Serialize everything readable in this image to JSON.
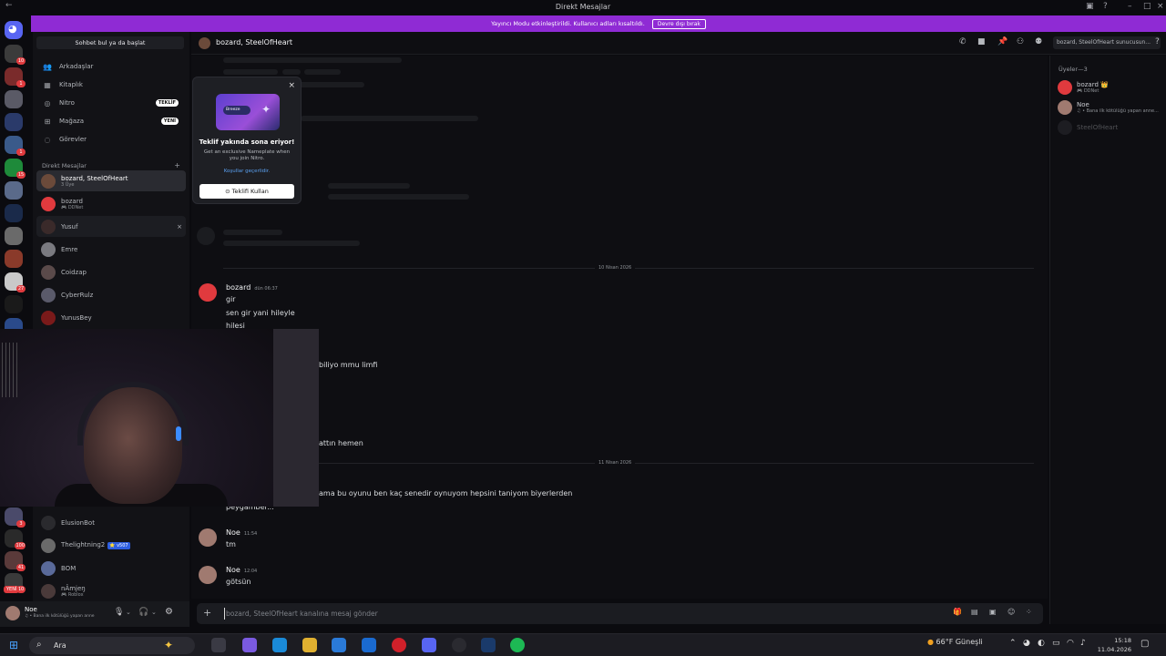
{
  "window": {
    "title": "Direkt Mesajlar"
  },
  "banner": {
    "text": "Yayıncı Modu etkinleştirildi. Kullanıcı adları kısaltıldı.",
    "button": "Devre dışı bırak"
  },
  "server_rail": {
    "badges": [
      "10",
      "1",
      "",
      "",
      "1",
      "15",
      "",
      "",
      "",
      "",
      "27",
      "",
      "",
      "",
      "",
      "",
      "",
      "",
      "",
      "",
      "",
      "3",
      "100",
      "41",
      "10"
    ],
    "new_label": "YENİ"
  },
  "dm_sidebar": {
    "search_label": "Sohbet bul ya da başlat",
    "nav": [
      {
        "label": "Arkadaşlar",
        "icon": "friends-icon",
        "pill": ""
      },
      {
        "label": "Kitaplık",
        "icon": "library-icon",
        "pill": ""
      },
      {
        "label": "Nitro",
        "icon": "nitro-icon",
        "pill": "TEKLİF"
      },
      {
        "label": "Mağaza",
        "icon": "shop-icon",
        "pill": "YENİ"
      },
      {
        "label": "Görevler",
        "icon": "quests-icon",
        "pill": ""
      }
    ],
    "section_label": "Direkt Mesajlar",
    "dms": [
      {
        "name": "bozard, SteelOfHeart",
        "sub": "3 Üye",
        "color": "#6b4a3a"
      },
      {
        "name": "bozard",
        "sub": "🎮 DDNet",
        "color": "#e03a3e"
      },
      {
        "name": "Yusuf",
        "sub": "",
        "color": "#3a2a2a"
      },
      {
        "name": "Emre",
        "sub": "",
        "color": "#7a7a80"
      },
      {
        "name": "Coidzap",
        "sub": "",
        "color": "#5a4a4a"
      },
      {
        "name": "CyberRulz",
        "sub": "",
        "color": "#5a5a6a"
      },
      {
        "name": "YunusBey",
        "sub": "",
        "color": "#7a1a1a"
      },
      {
        "name": "ElusionBot",
        "sub": "",
        "color": "#2a2a2e"
      },
      {
        "name": "Thelightning2",
        "sub": "",
        "color": "#6a6a6a",
        "tag": "⭐ v507"
      },
      {
        "name": "BOM",
        "sub": "",
        "color": "#5a6a9a"
      },
      {
        "name": "nÂmjeŋ",
        "sub": "🎮 Roblox",
        "color": "#4a3a3a"
      }
    ]
  },
  "user_panel": {
    "name": "Noe",
    "status": "♫ • Bana ilk kötülüğü yapan anne"
  },
  "chat_header": {
    "title": "bozard, SteelOfHeart",
    "search_placeholder": "bozard, SteelOfHeart sunucusun..."
  },
  "messages": {
    "dividers": [
      "10 Nisan 2026",
      "11 Nisan 2026"
    ],
    "groups": [
      {
        "author": "bozard",
        "time": "dün 06:37",
        "color": "#e03a3e",
        "lines": [
          "gir",
          "sen gir yani hileyle",
          "hilesi"
        ]
      },
      {
        "author": "",
        "time": "",
        "color": "",
        "lines": [
          "biliyo mmu limfi",
          "attın hemen",
          "ama bu oyunu ben kaç senedir oynuyom hepsini taniyom biyerlerden",
          "peygamber..."
        ]
      },
      {
        "author": "Noe",
        "time": "11:54",
        "color": "#a07a70",
        "lines": [
          "tm"
        ]
      },
      {
        "author": "Noe",
        "time": "12:04",
        "color": "#a07a70",
        "lines": [
          "götsün"
        ]
      }
    ]
  },
  "composer": {
    "placeholder": "bozard, SteelOfHeart kanalına mesaj gönder"
  },
  "members": {
    "header": "Üyeler—3",
    "list": [
      {
        "name": "bozard 👑",
        "sub": "🎮 DDNet",
        "color": "#e03a3e"
      },
      {
        "name": "Noe",
        "sub": "♫ • Bana ilk kötülüğü yapan anne...",
        "color": "#a07a70"
      },
      {
        "name": "SteelOfHeart",
        "sub": "",
        "color": "#3a3a40"
      }
    ]
  },
  "nitro_popup": {
    "title": "Teklif yakında sona eriyor!",
    "body": "Get an exclusive Nameplate when you join Nitro.",
    "link": "Koşullar geçerlidir.",
    "button": "Teklifi Kullan",
    "chip": "Breeze"
  },
  "taskbar": {
    "search": "Ara",
    "weather": "66°F Güneşli",
    "time": "15:18",
    "date": "11.04.2026"
  }
}
